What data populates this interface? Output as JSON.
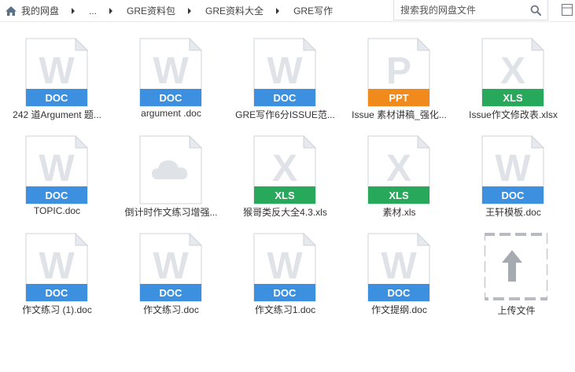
{
  "breadcrumb": {
    "items": [
      {
        "label": "我的网盘"
      },
      {
        "label": "..."
      },
      {
        "label": "GRE资料包"
      },
      {
        "label": "GRE资料大全"
      },
      {
        "label": "GRE写作"
      }
    ]
  },
  "search": {
    "placeholder": "搜索我的网盘文件"
  },
  "files": [
    {
      "name": "242 道Argument 题...",
      "type": "DOC",
      "letter": "W",
      "color": "#3d8fe0"
    },
    {
      "name": "argument .doc",
      "type": "DOC",
      "letter": "W",
      "color": "#3d8fe0"
    },
    {
      "name": "GRE写作6分ISSUE范...",
      "type": "DOC",
      "letter": "W",
      "color": "#3d8fe0"
    },
    {
      "name": "Issue 素材讲稿_强化...",
      "type": "PPT",
      "letter": "P",
      "color": "#f08a1c"
    },
    {
      "name": "Issue作文修改表.xlsx",
      "type": "XLS",
      "letter": "X",
      "color": "#27a85a"
    },
    {
      "name": "TOPIC.doc",
      "type": "DOC",
      "letter": "W",
      "color": "#3d8fe0"
    },
    {
      "name": "倒计时作文练习增强...",
      "type": "CLOUD",
      "letter": "",
      "color": "#dfe3e8"
    },
    {
      "name": "猴哥类反大全4.3.xls",
      "type": "XLS",
      "letter": "X",
      "color": "#27a85a"
    },
    {
      "name": "素材.xls",
      "type": "XLS",
      "letter": "X",
      "color": "#27a85a"
    },
    {
      "name": "王轩模板.doc",
      "type": "DOC",
      "letter": "W",
      "color": "#3d8fe0"
    },
    {
      "name": "作文练习 (1).doc",
      "type": "DOC",
      "letter": "W",
      "color": "#3d8fe0"
    },
    {
      "name": "作文练习.doc",
      "type": "DOC",
      "letter": "W",
      "color": "#3d8fe0"
    },
    {
      "name": "作文练习1.doc",
      "type": "DOC",
      "letter": "W",
      "color": "#3d8fe0"
    },
    {
      "name": "作文提纲.doc",
      "type": "DOC",
      "letter": "W",
      "color": "#3d8fe0"
    }
  ],
  "upload": {
    "label": "上传文件"
  }
}
